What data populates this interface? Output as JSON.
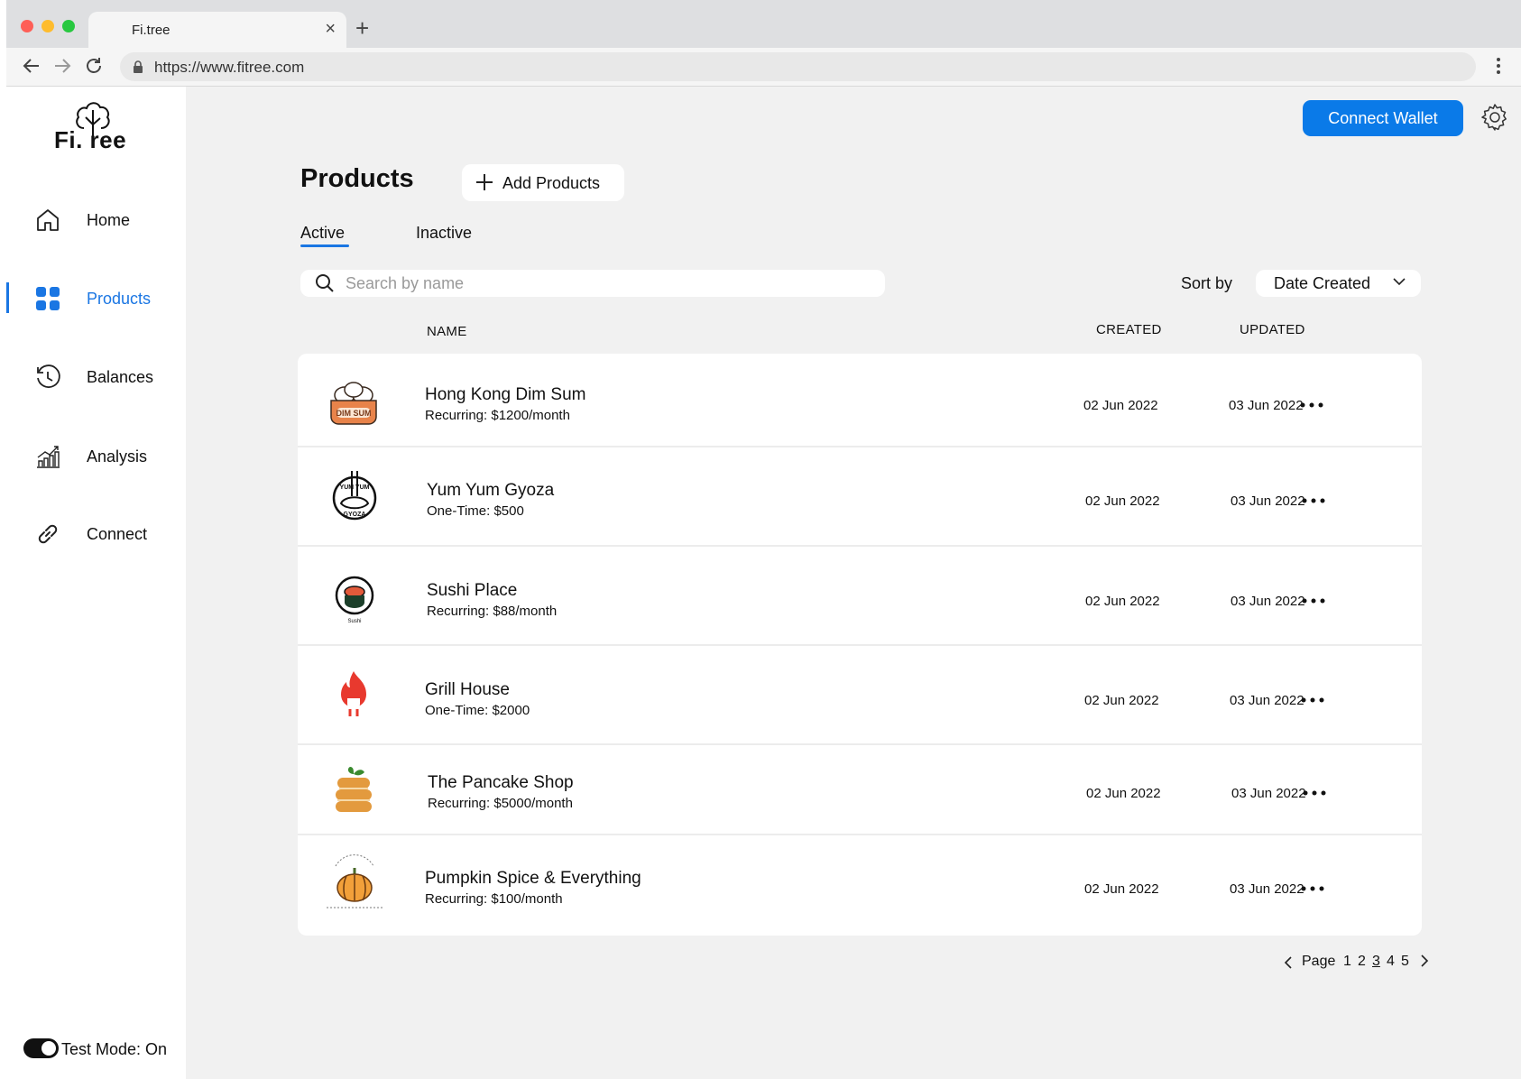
{
  "browser": {
    "tab_title": "Fi.tree",
    "url": "https://www.fitree.com"
  },
  "sidebar": {
    "logo_text": "Fi. ree",
    "items": [
      {
        "label": "Home",
        "icon": "home-icon"
      },
      {
        "label": "Products",
        "icon": "grid-icon"
      },
      {
        "label": "Balances",
        "icon": "history-icon"
      },
      {
        "label": "Analysis",
        "icon": "chart-icon"
      },
      {
        "label": "Connect",
        "icon": "link-icon"
      }
    ],
    "active_item": "Products",
    "test_mode_label": "Test Mode: On"
  },
  "header": {
    "connect_wallet_label": "Connect Wallet",
    "settings_icon": "gear-icon"
  },
  "main": {
    "title": "Products",
    "add_button_label": "Add Products",
    "tabs": [
      {
        "label": "Active",
        "selected": true
      },
      {
        "label": "Inactive",
        "selected": false
      }
    ],
    "search_placeholder": "Search by name",
    "sort_label": "Sort by",
    "sort_value": "Date Created",
    "columns": {
      "name": "NAME",
      "created": "CREATED",
      "updated": "UPDATED"
    },
    "products": [
      {
        "name": "Hong Kong Dim Sum",
        "price": "Recurring: $1200/month",
        "created": "02 Jun 2022",
        "updated": "03 Jun 2022",
        "logo": "dim-sum-logo"
      },
      {
        "name": "Yum Yum Gyoza",
        "price": "One-Time: $500",
        "created": "02 Jun 2022",
        "updated": "03 Jun 2022",
        "logo": "gyoza-logo"
      },
      {
        "name": "Sushi Place",
        "price": "Recurring: $88/month",
        "created": "02 Jun 2022",
        "updated": "03 Jun 2022",
        "logo": "sushi-logo"
      },
      {
        "name": "Grill House",
        "price": "One-Time: $2000",
        "created": "02 Jun 2022",
        "updated": "03 Jun 2022",
        "logo": "grill-logo"
      },
      {
        "name": "The Pancake Shop",
        "price": "Recurring: $5000/month",
        "created": "02 Jun 2022",
        "updated": "03 Jun 2022",
        "logo": "pancake-logo"
      },
      {
        "name": "Pumpkin Spice & Everything",
        "price": "Recurring: $100/month",
        "created": "02 Jun 2022",
        "updated": "03 Jun 2022",
        "logo": "pumpkin-logo"
      }
    ],
    "pagination": {
      "label": "Page",
      "pages": [
        "1",
        "2",
        "3",
        "4",
        "5"
      ],
      "current": "3"
    }
  },
  "colors": {
    "accent": "#1a76e3",
    "button": "#0a7ae8",
    "background": "#f1f1f1"
  }
}
